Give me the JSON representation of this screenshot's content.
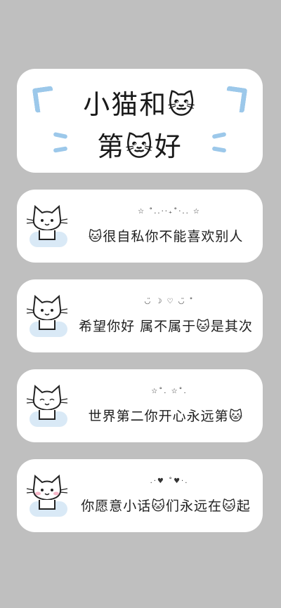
{
  "title": {
    "line1": "小猫和🐱",
    "line2": "第🐱好"
  },
  "cards": [
    {
      "deco": "☆ ˚..·‧₊˚‧.. ☆",
      "text": "🐱很自私你不能喜欢别人"
    },
    {
      "deco": "◡̈ ☽ ♡ ◡̈ ˚",
      "text": "希望你好 属不属于🐱是其次"
    },
    {
      "deco": "☆˚. ☆˚.",
      "text": "世界第二你开心永远第🐱"
    },
    {
      "deco": ".·♥ ˚♥·.",
      "text": "你愿意小话🐱们永远在🐱起"
    }
  ],
  "colors": {
    "accent": "#9cc8ea",
    "background": "#bfbfbf",
    "card": "#ffffff"
  },
  "icons": [
    "cat-icon",
    "bracket-icon"
  ]
}
